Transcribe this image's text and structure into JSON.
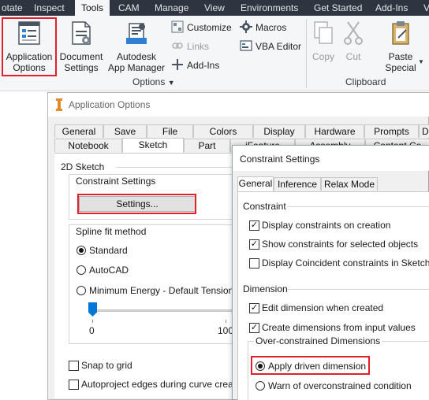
{
  "menubar": {
    "tabs": [
      {
        "label": "otate"
      },
      {
        "label": "Inspect"
      },
      {
        "label": "Tools",
        "active": true
      },
      {
        "label": "CAM"
      },
      {
        "label": "Manage"
      },
      {
        "label": "View"
      },
      {
        "label": "Environments"
      },
      {
        "label": "Get Started"
      },
      {
        "label": "Add-Ins"
      },
      {
        "label": "V"
      }
    ]
  },
  "ribbon": {
    "options_panel": {
      "label": "Options",
      "application_options": {
        "line1": "Application",
        "line2": "Options"
      },
      "document_settings": {
        "line1": "Document",
        "line2": "Settings"
      },
      "app_manager": {
        "line1": "Autodesk",
        "line2": "App Manager"
      },
      "customize": "Customize",
      "links": "Links",
      "add_ins": "Add-Ins",
      "macros": "Macros",
      "vba_editor": "VBA Editor"
    },
    "clipboard_panel": {
      "label": "Clipboard",
      "copy": "Copy",
      "cut": "Cut",
      "paste_special": {
        "line1": "Paste",
        "line2": "Special"
      }
    },
    "highlight_color": "#e0202c"
  },
  "app_options": {
    "title": "Application Options",
    "tabs_row1": [
      "General",
      "Save",
      "File",
      "Colors",
      "Display",
      "Hardware",
      "Prompts",
      "D"
    ],
    "tabs_row2": [
      "Notebook",
      "Sketch",
      "Part",
      "iFeature",
      "Assembly",
      "Content Ce"
    ],
    "active_tab": "Sketch",
    "section_2d_sketch": "2D Sketch",
    "constraint_settings_label": "Constraint Settings",
    "settings_button": "Settings...",
    "spline_fit_label": "Spline fit method",
    "spline_options": {
      "standard": "Standard",
      "autocad": "AutoCAD",
      "min_energy": "Minimum Energy - Default Tension"
    },
    "spline_selected": "Standard",
    "tension_min": "0",
    "tension_max": "100",
    "tension_value": 0,
    "snap_to_grid": "Snap to grid",
    "autoproject": "Autoproject edges during curve creation"
  },
  "constraint_settings": {
    "title": "Constraint Settings",
    "tabs": [
      "General",
      "Inference",
      "Relax Mode"
    ],
    "active_tab": "General",
    "constraint_section": "Constraint",
    "display_on_creation": {
      "label": "Display constraints on creation",
      "checked": true
    },
    "show_for_selected": {
      "label": "Show constraints for selected objects",
      "checked": true
    },
    "display_coincident": {
      "label": "Display Coincident constraints in Sketch",
      "checked": false
    },
    "dimension_section": "Dimension",
    "edit_when_created": {
      "label": "Edit dimension when created",
      "checked": true
    },
    "create_from_input": {
      "label": "Create dimensions from input values",
      "checked": true
    },
    "over_constrained": "Over-constrained Dimensions",
    "apply_driven": "Apply driven dimension",
    "warn_over": "Warn of overconstrained condition",
    "over_selected": "Apply driven dimension"
  }
}
